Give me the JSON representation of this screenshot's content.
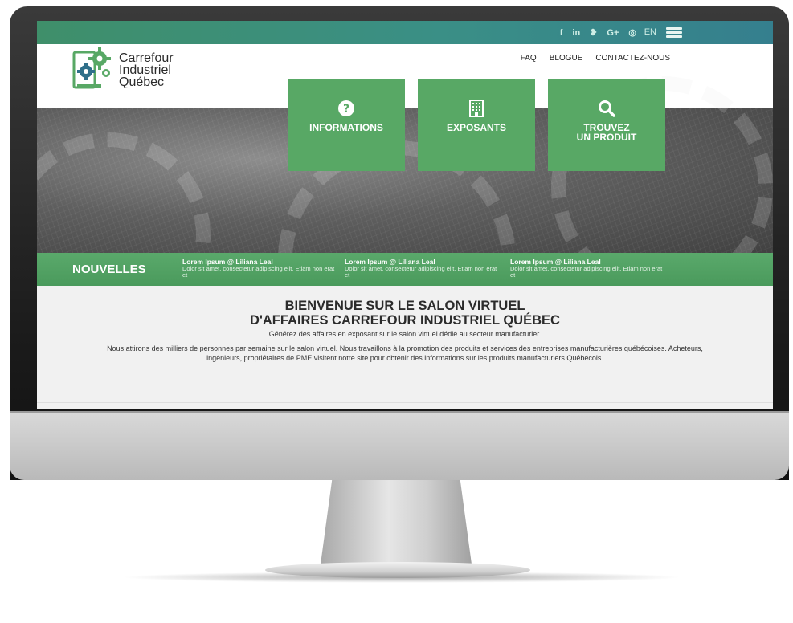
{
  "topbar": {
    "social_icons": [
      {
        "name": "facebook-icon",
        "glyph": "f"
      },
      {
        "name": "linkedin-icon",
        "glyph": "in"
      },
      {
        "name": "twitter-icon",
        "glyph": "❥"
      },
      {
        "name": "google-plus-icon",
        "glyph": "G+"
      },
      {
        "name": "instagram-icon",
        "glyph": "◎"
      }
    ],
    "language": "EN"
  },
  "logo": {
    "line1": "Carrefour",
    "line2": "Industriel",
    "line3": "Québec"
  },
  "nav": {
    "faq": "FAQ",
    "blog": "BLOGUE",
    "contact": "CONTACTEZ-NOUS"
  },
  "tiles": {
    "informations": {
      "label": "INFORMATIONS",
      "icon": "question-circle-icon"
    },
    "exposants": {
      "label": "EXPOSANTS",
      "icon": "building-icon"
    },
    "produit": {
      "label_line1": "TROUVEZ",
      "label_line2": "UN PRODUIT",
      "icon": "search-icon"
    }
  },
  "news": {
    "title": "NOUVELLES",
    "items": [
      {
        "title": "Lorem Ipsum @ Liliana Leal",
        "text": "Dolor sit amet, consectetur adipiscing elit. Etiam non erat et"
      },
      {
        "title": "Lorem Ipsum @ Liliana Leal",
        "text": "Dolor sit amet, consectetur adipiscing elit. Etiam non erat et"
      },
      {
        "title": "Lorem Ipsum @ Liliana Leal",
        "text": "Dolor sit amet, consectetur adipiscing elit. Etiam non erat et"
      }
    ]
  },
  "welcome": {
    "title_line1": "BIENVENUE SUR LE SALON VIRTUEL",
    "title_line2": "D'AFFAIRES CARREFOUR INDUSTRIEL QUÉBEC",
    "subtitle": "Générez des affaires en exposant sur le salon virtuel dédié au secteur manufacturier.",
    "body": "Nous attirons des milliers de personnes par semaine sur le salon virtuel. Nous travaillons à la promotion des produits et services des entreprises manufacturières québécoises. Acheteurs, ingénieurs, propriétaires de PME visitent notre site pour obtenir des informations sur les produits manufacturiers Québécois."
  },
  "colors": {
    "brand_green": "#58a865",
    "topbar_teal": "#3a8f86",
    "news_green": "#4a9a5c"
  }
}
